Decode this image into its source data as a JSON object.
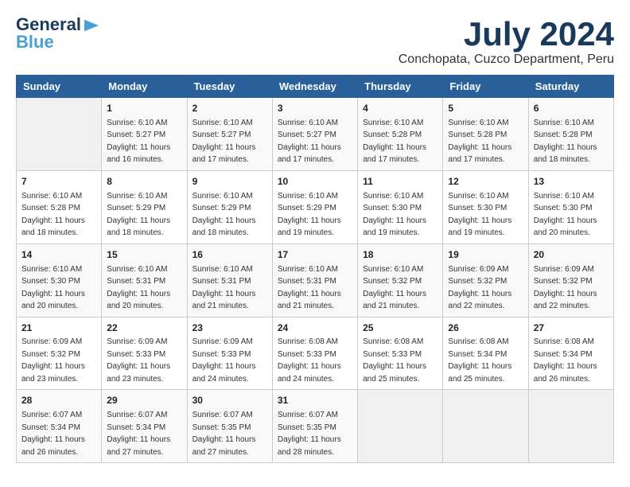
{
  "logo": {
    "line1": "General",
    "line2": "Blue",
    "tagline": ""
  },
  "title": "July 2024",
  "location": "Conchopata, Cuzco Department, Peru",
  "days_of_week": [
    "Sunday",
    "Monday",
    "Tuesday",
    "Wednesday",
    "Thursday",
    "Friday",
    "Saturday"
  ],
  "weeks": [
    [
      {
        "day": "",
        "info": ""
      },
      {
        "day": "1",
        "info": "Sunrise: 6:10 AM\nSunset: 5:27 PM\nDaylight: 11 hours\nand 16 minutes."
      },
      {
        "day": "2",
        "info": "Sunrise: 6:10 AM\nSunset: 5:27 PM\nDaylight: 11 hours\nand 17 minutes."
      },
      {
        "day": "3",
        "info": "Sunrise: 6:10 AM\nSunset: 5:27 PM\nDaylight: 11 hours\nand 17 minutes."
      },
      {
        "day": "4",
        "info": "Sunrise: 6:10 AM\nSunset: 5:28 PM\nDaylight: 11 hours\nand 17 minutes."
      },
      {
        "day": "5",
        "info": "Sunrise: 6:10 AM\nSunset: 5:28 PM\nDaylight: 11 hours\nand 17 minutes."
      },
      {
        "day": "6",
        "info": "Sunrise: 6:10 AM\nSunset: 5:28 PM\nDaylight: 11 hours\nand 18 minutes."
      }
    ],
    [
      {
        "day": "7",
        "info": "Sunrise: 6:10 AM\nSunset: 5:28 PM\nDaylight: 11 hours\nand 18 minutes."
      },
      {
        "day": "8",
        "info": "Sunrise: 6:10 AM\nSunset: 5:29 PM\nDaylight: 11 hours\nand 18 minutes."
      },
      {
        "day": "9",
        "info": "Sunrise: 6:10 AM\nSunset: 5:29 PM\nDaylight: 11 hours\nand 18 minutes."
      },
      {
        "day": "10",
        "info": "Sunrise: 6:10 AM\nSunset: 5:29 PM\nDaylight: 11 hours\nand 19 minutes."
      },
      {
        "day": "11",
        "info": "Sunrise: 6:10 AM\nSunset: 5:30 PM\nDaylight: 11 hours\nand 19 minutes."
      },
      {
        "day": "12",
        "info": "Sunrise: 6:10 AM\nSunset: 5:30 PM\nDaylight: 11 hours\nand 19 minutes."
      },
      {
        "day": "13",
        "info": "Sunrise: 6:10 AM\nSunset: 5:30 PM\nDaylight: 11 hours\nand 20 minutes."
      }
    ],
    [
      {
        "day": "14",
        "info": "Sunrise: 6:10 AM\nSunset: 5:30 PM\nDaylight: 11 hours\nand 20 minutes."
      },
      {
        "day": "15",
        "info": "Sunrise: 6:10 AM\nSunset: 5:31 PM\nDaylight: 11 hours\nand 20 minutes."
      },
      {
        "day": "16",
        "info": "Sunrise: 6:10 AM\nSunset: 5:31 PM\nDaylight: 11 hours\nand 21 minutes."
      },
      {
        "day": "17",
        "info": "Sunrise: 6:10 AM\nSunset: 5:31 PM\nDaylight: 11 hours\nand 21 minutes."
      },
      {
        "day": "18",
        "info": "Sunrise: 6:10 AM\nSunset: 5:32 PM\nDaylight: 11 hours\nand 21 minutes."
      },
      {
        "day": "19",
        "info": "Sunrise: 6:09 AM\nSunset: 5:32 PM\nDaylight: 11 hours\nand 22 minutes."
      },
      {
        "day": "20",
        "info": "Sunrise: 6:09 AM\nSunset: 5:32 PM\nDaylight: 11 hours\nand 22 minutes."
      }
    ],
    [
      {
        "day": "21",
        "info": "Sunrise: 6:09 AM\nSunset: 5:32 PM\nDaylight: 11 hours\nand 23 minutes."
      },
      {
        "day": "22",
        "info": "Sunrise: 6:09 AM\nSunset: 5:33 PM\nDaylight: 11 hours\nand 23 minutes."
      },
      {
        "day": "23",
        "info": "Sunrise: 6:09 AM\nSunset: 5:33 PM\nDaylight: 11 hours\nand 24 minutes."
      },
      {
        "day": "24",
        "info": "Sunrise: 6:08 AM\nSunset: 5:33 PM\nDaylight: 11 hours\nand 24 minutes."
      },
      {
        "day": "25",
        "info": "Sunrise: 6:08 AM\nSunset: 5:33 PM\nDaylight: 11 hours\nand 25 minutes."
      },
      {
        "day": "26",
        "info": "Sunrise: 6:08 AM\nSunset: 5:34 PM\nDaylight: 11 hours\nand 25 minutes."
      },
      {
        "day": "27",
        "info": "Sunrise: 6:08 AM\nSunset: 5:34 PM\nDaylight: 11 hours\nand 26 minutes."
      }
    ],
    [
      {
        "day": "28",
        "info": "Sunrise: 6:07 AM\nSunset: 5:34 PM\nDaylight: 11 hours\nand 26 minutes."
      },
      {
        "day": "29",
        "info": "Sunrise: 6:07 AM\nSunset: 5:34 PM\nDaylight: 11 hours\nand 27 minutes."
      },
      {
        "day": "30",
        "info": "Sunrise: 6:07 AM\nSunset: 5:35 PM\nDaylight: 11 hours\nand 27 minutes."
      },
      {
        "day": "31",
        "info": "Sunrise: 6:07 AM\nSunset: 5:35 PM\nDaylight: 11 hours\nand 28 minutes."
      },
      {
        "day": "",
        "info": ""
      },
      {
        "day": "",
        "info": ""
      },
      {
        "day": "",
        "info": ""
      }
    ]
  ]
}
